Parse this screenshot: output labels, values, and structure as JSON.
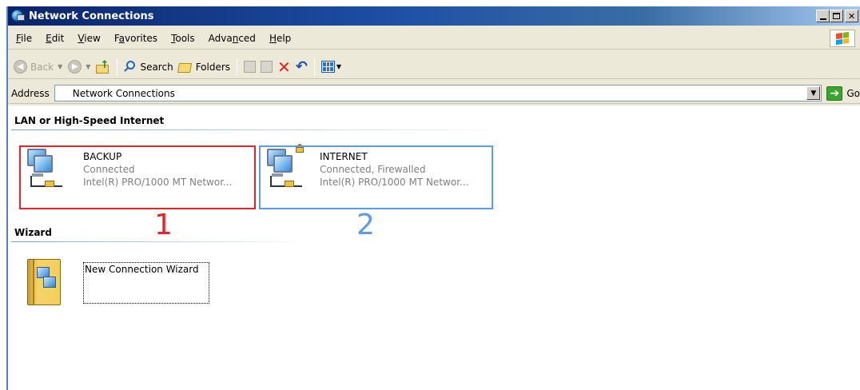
{
  "window": {
    "title": "Network Connections"
  },
  "menu": {
    "items": [
      {
        "label": "File",
        "accel": "F",
        "rest": "ile"
      },
      {
        "label": "Edit",
        "accel": "E",
        "rest": "dit"
      },
      {
        "label": "View",
        "accel": "V",
        "rest": "iew"
      },
      {
        "label": "Favorites",
        "pre": "F",
        "accel": "a",
        "rest": "vorites"
      },
      {
        "label": "Tools",
        "accel": "T",
        "rest": "ools"
      },
      {
        "label": "Advanced",
        "pre": "Adva",
        "accel": "n",
        "rest": "ced"
      },
      {
        "label": "Help",
        "accel": "H",
        "rest": "elp"
      }
    ]
  },
  "toolbar": {
    "back_label": "Back",
    "search_label": "Search",
    "folders_label": "Folders"
  },
  "address": {
    "label": "Address",
    "value": "Network Connections",
    "go_label": "Go"
  },
  "groups": {
    "lan_header": "LAN or High-Speed Internet",
    "wizard_header": "Wizard"
  },
  "connections": [
    {
      "name": "BACKUP",
      "status": "Connected",
      "device": "Intel(R) PRO/1000 MT Networ...",
      "firewalled": false
    },
    {
      "name": "INTERNET",
      "status": "Connected, Firewalled",
      "device": "Intel(R) PRO/1000 MT Networ...",
      "firewalled": true
    }
  ],
  "wizard": {
    "label": "New Connection Wizard"
  },
  "annotations": [
    {
      "number": "1",
      "color": "#e8242b"
    },
    {
      "number": "2",
      "color": "#5b9bea"
    }
  ]
}
